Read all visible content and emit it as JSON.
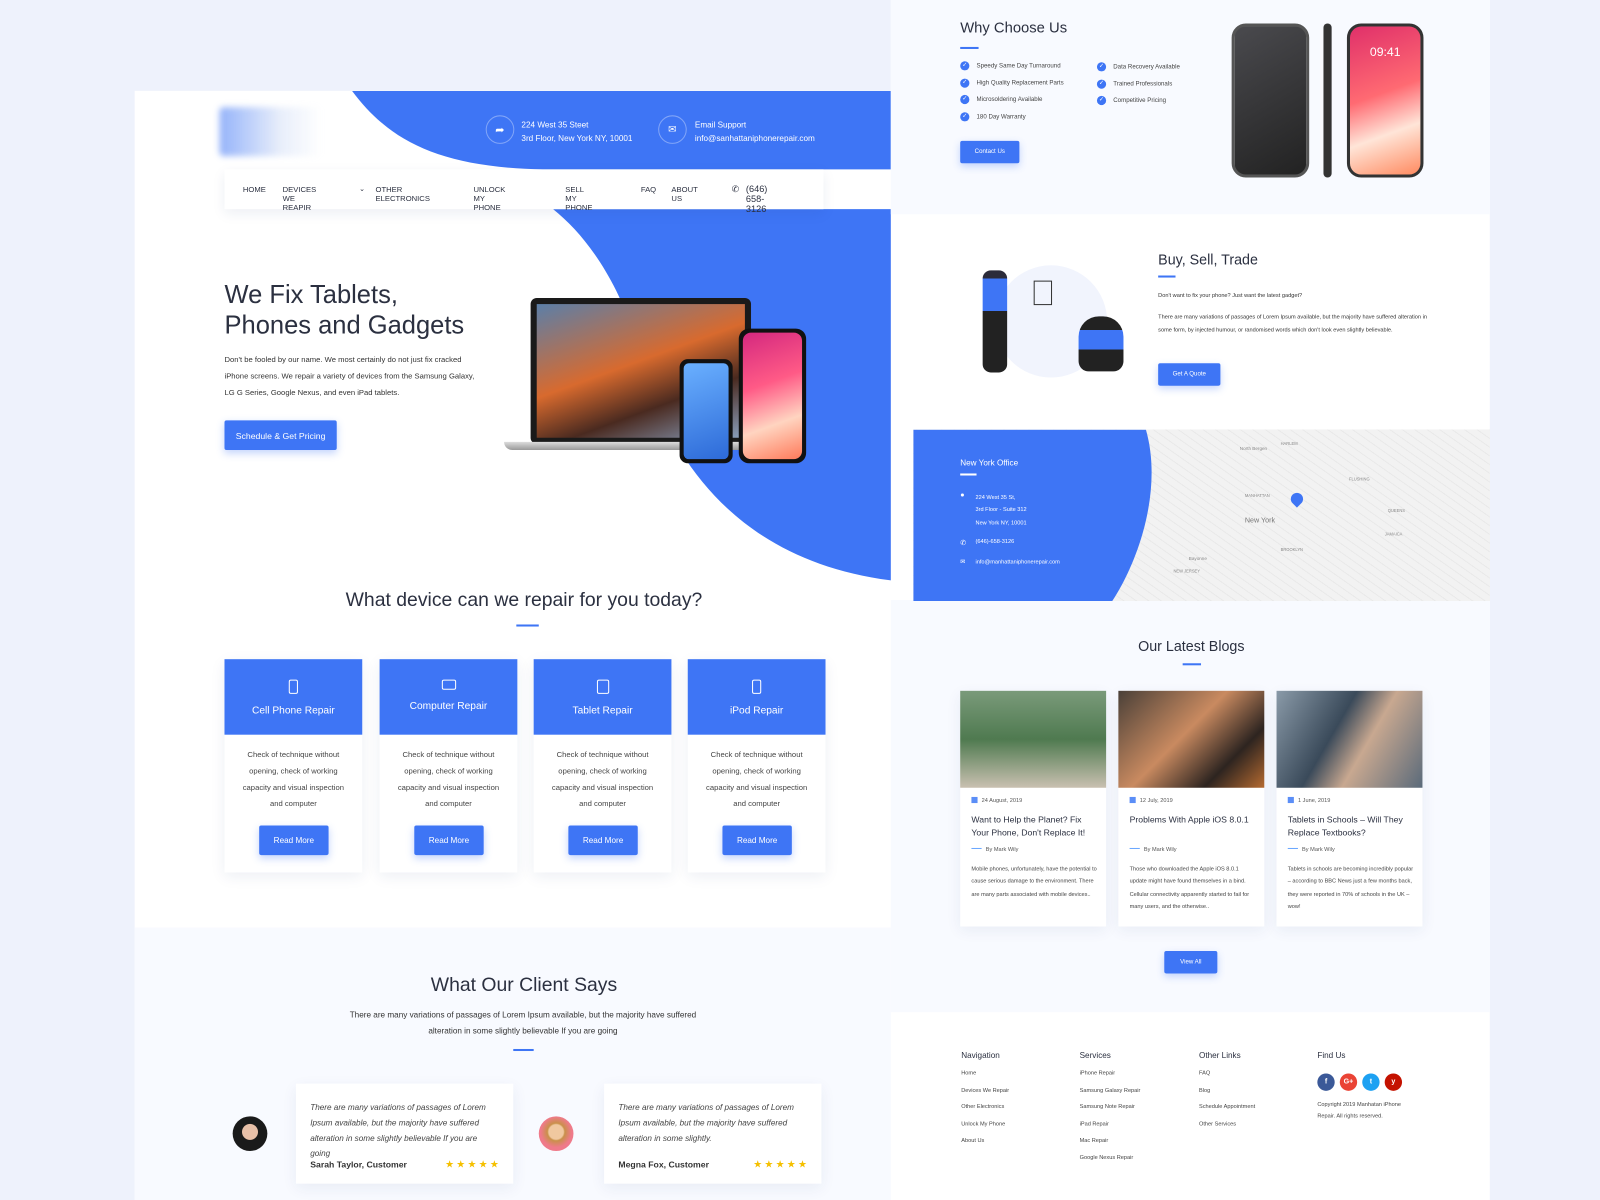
{
  "colors": {
    "accent": "#3e75f5",
    "star": "#f5c000"
  },
  "header": {
    "address": {
      "icon": "share-arrow-icon",
      "line1": "224 West 35 Steet",
      "line2": "3rd Floor, New York NY, 10001"
    },
    "email": {
      "icon": "envelope-icon",
      "line1": "Email Support",
      "line2": "info@sanhattaniphonerepair.com"
    }
  },
  "nav": {
    "items": [
      "HOME",
      "DEVICES WE REAPIR",
      "OTHER ELECTRONICS",
      "UNLOCK MY PHONE",
      "SELL MY PHONE",
      "FAQ",
      "ABOUT US"
    ],
    "phone": "(646) 658-3126"
  },
  "hero": {
    "title_line1": "We Fix Tablets,",
    "title_line2": "Phones and Gadgets",
    "text": "Don't be fooled by our name. We most certainly do not just fix cracked iPhone screens. We repair a variety of devices from the Samsung Galaxy, LG G Series, Google Nexus, and even iPad tablets.",
    "cta": "Schedule & Get Pricing"
  },
  "devices": {
    "title": "What device can we repair for you today?",
    "cards": [
      {
        "icon": "phone-icon",
        "title": "Cell Phone Repair",
        "text": "Check of technique without opening, check of working capacity and visual inspection and computer",
        "button": "Read More"
      },
      {
        "icon": "laptop-icon",
        "title": "Computer Repair",
        "text": "Check of technique without opening, check of working capacity and visual inspection and computer",
        "button": "Read More"
      },
      {
        "icon": "tablet-icon",
        "title": "Tablet Repair",
        "text": "Check of technique without opening, check of working capacity and visual inspection and computer",
        "button": "Read More"
      },
      {
        "icon": "ipod-icon",
        "title": "iPod Repair",
        "text": "Check of technique without opening, check of working capacity and visual inspection and computer",
        "button": "Read More"
      }
    ]
  },
  "testimonials": {
    "title": "What Our Client Says",
    "subtitle": "There are many variations of passages of Lorem Ipsum available, but the majority have suffered alteration in some slightly believable If you are going",
    "items": [
      {
        "text": "There are many variations of passages of Lorem Ipsum available, but the majority have suffered alteration in some slightly believable If you are going",
        "name": "Sarah Taylor, Customer",
        "rating": 5
      },
      {
        "text": "There are many variations of passages of Lorem Ipsum available, but the majority have suffered alteration in some slightly.",
        "name": "Megna Fox, Customer",
        "rating": 5
      }
    ]
  },
  "why": {
    "title": "Why Choose Us",
    "items_left": [
      "Speedy Same Day Turnaround",
      "High Quality Replacement Parts",
      "Microsoldering Available",
      "180 Day Warranty"
    ],
    "items_right": [
      "Data Recovery Available",
      "Trained Professionals",
      "Competitive Pricing"
    ],
    "button": "Contact Us",
    "phone_time": "09:41"
  },
  "trade": {
    "title": "Buy, Sell, Trade",
    "lead": "Don't want to fix your phone? Just want the latest gadget?",
    "text": "There are many variations of passages of Lorem Ipsum available, but the majority have suffered alteration in some form, by injected humour, or randomised words which don't look even slightly believable.",
    "button": "Get A Quote"
  },
  "office": {
    "title": "New York Office",
    "address1": "224 West 35 St,",
    "address2": "3rd Floor - Suite 312",
    "address3": "New York NY, 10001",
    "phone": "(646)-658-3126",
    "email": "info@manhattaniphonerepair.com",
    "map_labels": [
      "New York",
      "MANHATTAN",
      "BROOKLYN",
      "QUEENS",
      "North Bergen",
      "HARLEM",
      "FLUSHING",
      "JAMAICA",
      "Bayonne",
      "NEW JERSEY"
    ]
  },
  "blogs": {
    "title": "Our Latest Blogs",
    "items": [
      {
        "date": "24 August, 2019",
        "title": "Want to Help the Planet? Fix Your Phone, Don't Replace It!",
        "author": "By Mark Wily",
        "excerpt": "Mobile phones, unfortunately, have the potential to cause serious damage to the environment. There are many parts associated with mobile devices.."
      },
      {
        "date": "12 July, 2019",
        "title": "Problems With Apple iOS 8.0.1",
        "author": "By Mark Wily",
        "excerpt": "Those who downloaded the Apple iOS 8.0.1 update might have found themselves in a bind. Cellular connectivity apparently started to fail for many users, and the otherwise.."
      },
      {
        "date": "1 June, 2019",
        "title": "Tablets in Schools – Will They Replace Textbooks?",
        "author": "By Mark Wily",
        "excerpt": "Tablets in schools are becoming incredibly popular – according to BBC News just a few months back, they were reported in 70% of schools in the UK – wow!"
      }
    ],
    "button": "View All"
  },
  "footer": {
    "navigation": {
      "title": "Navigation",
      "links": [
        "Home",
        "Devices We Repair",
        "Other Electronics",
        "Unlock My Phone",
        "About Us"
      ]
    },
    "services": {
      "title": "Services",
      "links": [
        "iPhone Repair",
        "Samsung Galaxy Repair",
        "Samsung Note Repair",
        "iPad Repair",
        "Mac Repair",
        "Google Nexus Repair"
      ]
    },
    "other": {
      "title": "Other Links",
      "links": [
        "FAQ",
        "Blog",
        "Schedule Appointment",
        "Other Services"
      ]
    },
    "find": {
      "title": "Find Us",
      "social": [
        "facebook-icon",
        "google-plus-icon",
        "twitter-icon",
        "yelp-icon"
      ],
      "copyright": "Copyright 2019 Manhatan iPhone Repair. All rights reserved."
    }
  }
}
